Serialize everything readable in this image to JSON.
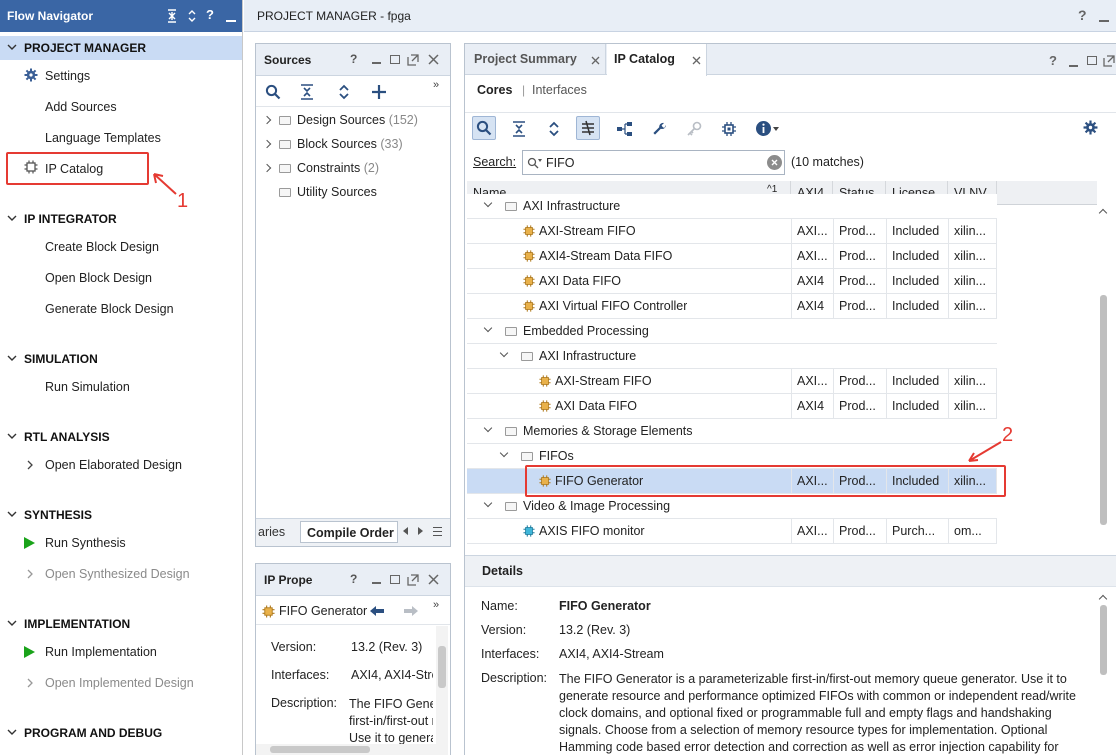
{
  "flow_navigator": {
    "title": "Flow Navigator",
    "sections": [
      {
        "key": "pm",
        "label": "PROJECT MANAGER",
        "items": [
          "Settings",
          "Add Sources",
          "Language Templates",
          "IP Catalog"
        ]
      },
      {
        "key": "ipi",
        "label": "IP INTEGRATOR",
        "items": [
          "Create Block Design",
          "Open Block Design",
          "Generate Block Design"
        ]
      },
      {
        "key": "sim",
        "label": "SIMULATION",
        "items": [
          "Run Simulation"
        ]
      },
      {
        "key": "rtl",
        "label": "RTL ANALYSIS",
        "items": [
          "Open Elaborated Design"
        ]
      },
      {
        "key": "syn",
        "label": "SYNTHESIS",
        "items": [
          "Run Synthesis",
          "Open Synthesized Design"
        ]
      },
      {
        "key": "impl",
        "label": "IMPLEMENTATION",
        "items": [
          "Run Implementation",
          "Open Implemented Design"
        ]
      },
      {
        "key": "pgm",
        "label": "PROGRAM AND DEBUG",
        "items": []
      }
    ]
  },
  "annotations": {
    "one": "1",
    "two": "2"
  },
  "project_manager": {
    "title": "PROJECT MANAGER - fpga"
  },
  "sources": {
    "title": "Sources",
    "tree": [
      {
        "label": "Design Sources",
        "count": "(152)"
      },
      {
        "label": "Block Sources",
        "count": "(33)"
      },
      {
        "label": "Constraints",
        "count": "(2)"
      },
      {
        "label": "Utility Sources",
        "count": ""
      }
    ],
    "tabs": {
      "left": "aries",
      "active": "Compile Order"
    }
  },
  "ip_props": {
    "title": "IP Prope",
    "name": "FIFO Generator",
    "version_k": "Version:",
    "version_v": "13.2 (Rev. 3)",
    "interfaces_k": "Interfaces:",
    "interfaces_v": "AXI4, AXI4-Strea",
    "desc_k": "Description:",
    "desc_l1": "The FIFO Gener",
    "desc_l2": "first-in/first-out r",
    "desc_l3": "Use it to genera"
  },
  "catalog": {
    "tabs": [
      "Project Summary",
      "IP Catalog"
    ],
    "subtabs": {
      "cores": "Cores",
      "sep": "|",
      "interfaces": "Interfaces"
    },
    "search_label": "Search:",
    "search_value": "FIFO",
    "matches": "(10 matches)",
    "columns": {
      "name": "Name",
      "sort": "^1",
      "axi4": "AXI4",
      "status": "Status",
      "license": "License",
      "vlnv": "VLNV"
    },
    "rows": [
      {
        "type": "folder",
        "indent": 1,
        "label": "AXI Infrastructure"
      },
      {
        "type": "ip",
        "indent": 2,
        "label": "AXI-Stream FIFO",
        "axi4": "AXI...",
        "status": "Prod...",
        "license": "Included",
        "vlnv": "xilin..."
      },
      {
        "type": "ip",
        "indent": 2,
        "label": "AXI4-Stream Data FIFO",
        "axi4": "AXI...",
        "status": "Prod...",
        "license": "Included",
        "vlnv": "xilin..."
      },
      {
        "type": "ip",
        "indent": 2,
        "label": "AXI Data FIFO",
        "axi4": "AXI4",
        "status": "Prod...",
        "license": "Included",
        "vlnv": "xilin..."
      },
      {
        "type": "ip",
        "indent": 2,
        "label": "AXI Virtual FIFO Controller",
        "axi4": "AXI4",
        "status": "Prod...",
        "license": "Included",
        "vlnv": "xilin..."
      },
      {
        "type": "folder",
        "indent": 1,
        "label": "Embedded Processing"
      },
      {
        "type": "folder",
        "indent": 2,
        "label": "AXI Infrastructure"
      },
      {
        "type": "ip",
        "indent": 3,
        "label": "AXI-Stream FIFO",
        "axi4": "AXI...",
        "status": "Prod...",
        "license": "Included",
        "vlnv": "xilin..."
      },
      {
        "type": "ip",
        "indent": 3,
        "label": "AXI Data FIFO",
        "axi4": "AXI4",
        "status": "Prod...",
        "license": "Included",
        "vlnv": "xilin..."
      },
      {
        "type": "folder",
        "indent": 1,
        "label": "Memories & Storage Elements"
      },
      {
        "type": "folder",
        "indent": 2,
        "label": "FIFOs"
      },
      {
        "type": "ip",
        "indent": 3,
        "label": "FIFO Generator",
        "axi4": "AXI...",
        "status": "Prod...",
        "license": "Included",
        "vlnv": "xilin...",
        "selected": true
      },
      {
        "type": "folder",
        "indent": 1,
        "label": "Video & Image Processing"
      },
      {
        "type": "ip",
        "indent": 2,
        "label": "AXIS FIFO monitor",
        "axi4": "AXI...",
        "status": "Prod...",
        "license": "Purch...",
        "vlnv": "om..."
      }
    ]
  },
  "details": {
    "title": "Details",
    "name_k": "Name:",
    "name_v": "FIFO Generator",
    "version_k": "Version:",
    "version_v": "13.2 (Rev. 3)",
    "interfaces_k": "Interfaces:",
    "interfaces_v": "AXI4, AXI4-Stream",
    "desc_k": "Description:",
    "desc_lines": [
      "The FIFO Generator is a parameterizable first-in/first-out memory queue generator. Use it to",
      "generate resource and performance optimized FIFOs with common or independent read/write",
      "clock domains, and optional fixed or programmable full and empty flags and handshaking",
      "signals.  Choose from a selection of memory resource types for implementation.  Optional",
      "Hamming code based error detection and correction as well as error injection capability for"
    ]
  },
  "colors": {
    "nav_header": "#3a66a5",
    "selection": "#c9dbf4",
    "annotation": "#e53a32",
    "run": "#1aa31a"
  }
}
